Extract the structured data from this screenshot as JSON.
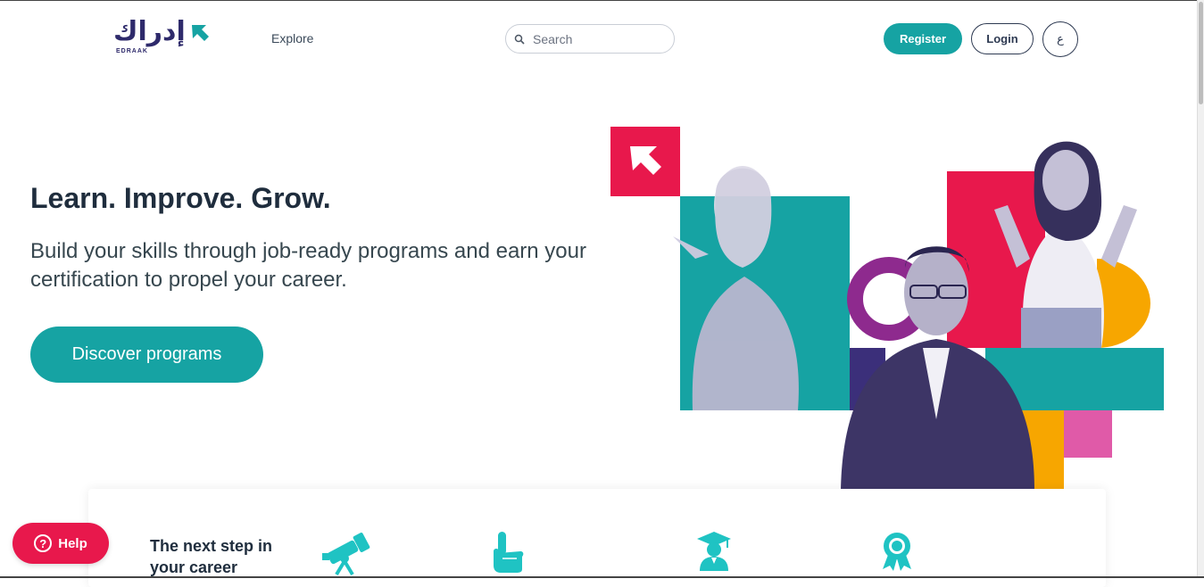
{
  "header": {
    "logo_text": "إدراك",
    "logo_latin": "EDRAAK",
    "explore_label": "Explore",
    "search_placeholder": "Search",
    "register_label": "Register",
    "login_label": "Login",
    "language_label": "ع"
  },
  "hero": {
    "title": "Learn. Improve. Grow.",
    "subtitle": "Build your skills through job-ready programs and earn your certification to propel your career.",
    "cta_label": "Discover programs"
  },
  "steps": {
    "title": "The next step in your career",
    "icons": [
      "telescope-icon",
      "pointing-hand-icon",
      "graduate-icon",
      "award-badge-icon"
    ]
  },
  "help": {
    "label": "Help"
  },
  "colors": {
    "teal": "#16a3a3",
    "navy": "#2e2a6b",
    "red": "#e8184c",
    "orange": "#f7a600",
    "purple": "#8e2a8e",
    "pink": "#e05aa8",
    "dark_text": "#1f2d3d"
  }
}
